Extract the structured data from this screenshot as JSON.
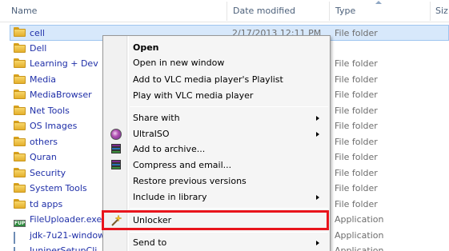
{
  "header": {
    "name": "Name",
    "date_modified": "Date modified",
    "type": "Type",
    "size": "Siz"
  },
  "files": [
    {
      "name": "cell",
      "date": "2/17/2013 12:11 PM",
      "type": "File folder",
      "icon": "folder-icon",
      "selected": true
    },
    {
      "name": "Dell",
      "date": "",
      "type": "",
      "icon": "folder-icon"
    },
    {
      "name": "Learning + Dev",
      "date": "",
      "type": "File folder",
      "icon": "folder-icon"
    },
    {
      "name": "Media",
      "date": "",
      "type": "File folder",
      "icon": "folder-icon"
    },
    {
      "name": "MediaBrowser",
      "date": "",
      "type": "File folder",
      "icon": "folder-icon"
    },
    {
      "name": "Net Tools",
      "date": "",
      "type": "File folder",
      "icon": "folder-icon"
    },
    {
      "name": "OS Images",
      "date": "",
      "type": "File folder",
      "icon": "folder-icon"
    },
    {
      "name": "others",
      "date": "",
      "type": "File folder",
      "icon": "folder-icon"
    },
    {
      "name": "Quran",
      "date": "",
      "type": "File folder",
      "icon": "folder-icon"
    },
    {
      "name": "Security",
      "date": "",
      "type": "File folder",
      "icon": "folder-icon"
    },
    {
      "name": "System Tools",
      "date": "",
      "type": "File folder",
      "icon": "folder-icon"
    },
    {
      "name": "td apps",
      "date": "",
      "type": "File folder",
      "icon": "folder-icon"
    },
    {
      "name": "FileUploader.exe",
      "date": "",
      "type": "Application",
      "icon": "fup-app-icon"
    },
    {
      "name": "jdk-7u21-window",
      "date": "",
      "type": "Application",
      "icon": "installer-icon"
    },
    {
      "name": "JuniperSetupCli",
      "date": "",
      "type": "Application",
      "icon": "installer-icon"
    }
  ],
  "context_menu": {
    "items": [
      {
        "label": "Open",
        "bold": true,
        "submenu": false,
        "icon": ""
      },
      {
        "label": "Open in new window",
        "submenu": false,
        "icon": ""
      },
      {
        "label": "Add to VLC media player's Playlist",
        "submenu": false,
        "icon": ""
      },
      {
        "label": "Play with VLC media player",
        "submenu": false,
        "icon": ""
      },
      {
        "label": "Share with",
        "submenu": true,
        "icon": ""
      },
      {
        "label": "UltraISO",
        "submenu": true,
        "icon": "ultraiso-icon"
      },
      {
        "label": "Add to archive...",
        "submenu": false,
        "icon": "winrar-icon"
      },
      {
        "label": "Compress and email...",
        "submenu": false,
        "icon": "winrar-icon"
      },
      {
        "label": "Restore previous versions",
        "submenu": false,
        "icon": ""
      },
      {
        "label": "Include in library",
        "submenu": true,
        "icon": ""
      },
      {
        "label": "Unlocker",
        "submenu": false,
        "icon": "unlocker-wand-icon",
        "highlighted": true
      },
      {
        "label": "Send to",
        "submenu": true,
        "icon": ""
      }
    ]
  },
  "colors": {
    "highlight_border": "#e8141c",
    "selection_bg": "#d7e8fb",
    "link_text": "#1f2fa8"
  }
}
